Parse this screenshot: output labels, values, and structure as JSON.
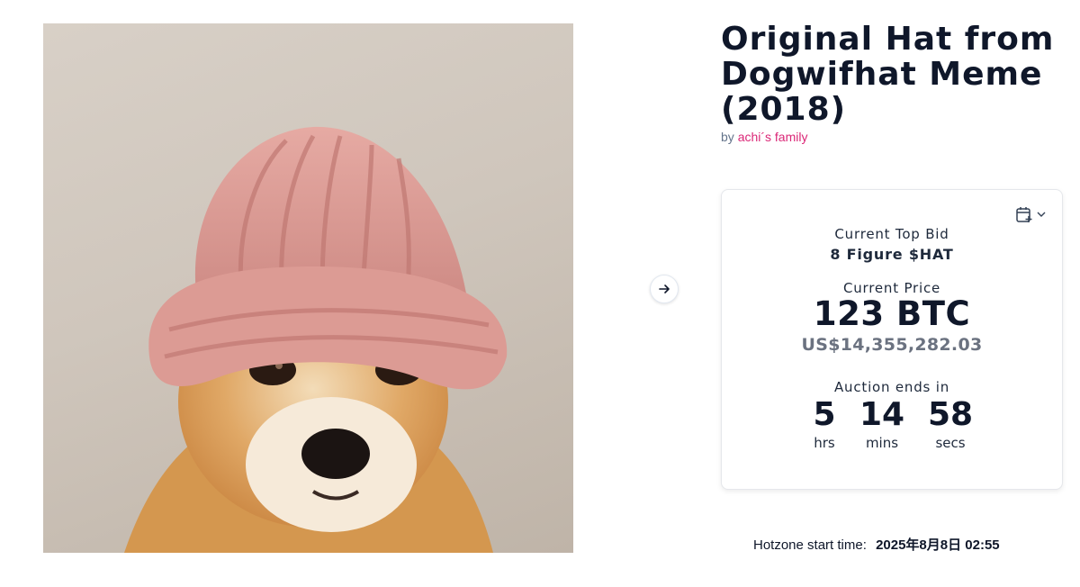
{
  "listing": {
    "title": "Original Hat from Dogwifhat Meme (2018)",
    "by_prefix": "by",
    "creator": "achi´s family"
  },
  "artwork": {
    "icon": "dog-with-pink-knit-hat-image"
  },
  "navigation": {
    "next_icon": "arrow-right-icon"
  },
  "auction": {
    "calendar_icon": "calendar-plus-icon",
    "dropdown_icon": "chevron-down-icon",
    "top_bid_label": "Current Top Bid",
    "top_bid_value": "8 Figure $HAT",
    "price_label": "Current Price",
    "price_value": "123 BTC",
    "price_usd": "US$14,355,282.03",
    "ends_label": "Auction ends in",
    "countdown": [
      {
        "value": "5",
        "unit": "hrs"
      },
      {
        "value": "14",
        "unit": "mins"
      },
      {
        "value": "58",
        "unit": "secs"
      }
    ]
  },
  "hotzone": {
    "label": "Hotzone start time:",
    "value": "2025年8月8日 02:55"
  },
  "colors": {
    "accent_link": "#db2777",
    "text_primary": "#0f172a",
    "text_muted": "#6b7280"
  }
}
